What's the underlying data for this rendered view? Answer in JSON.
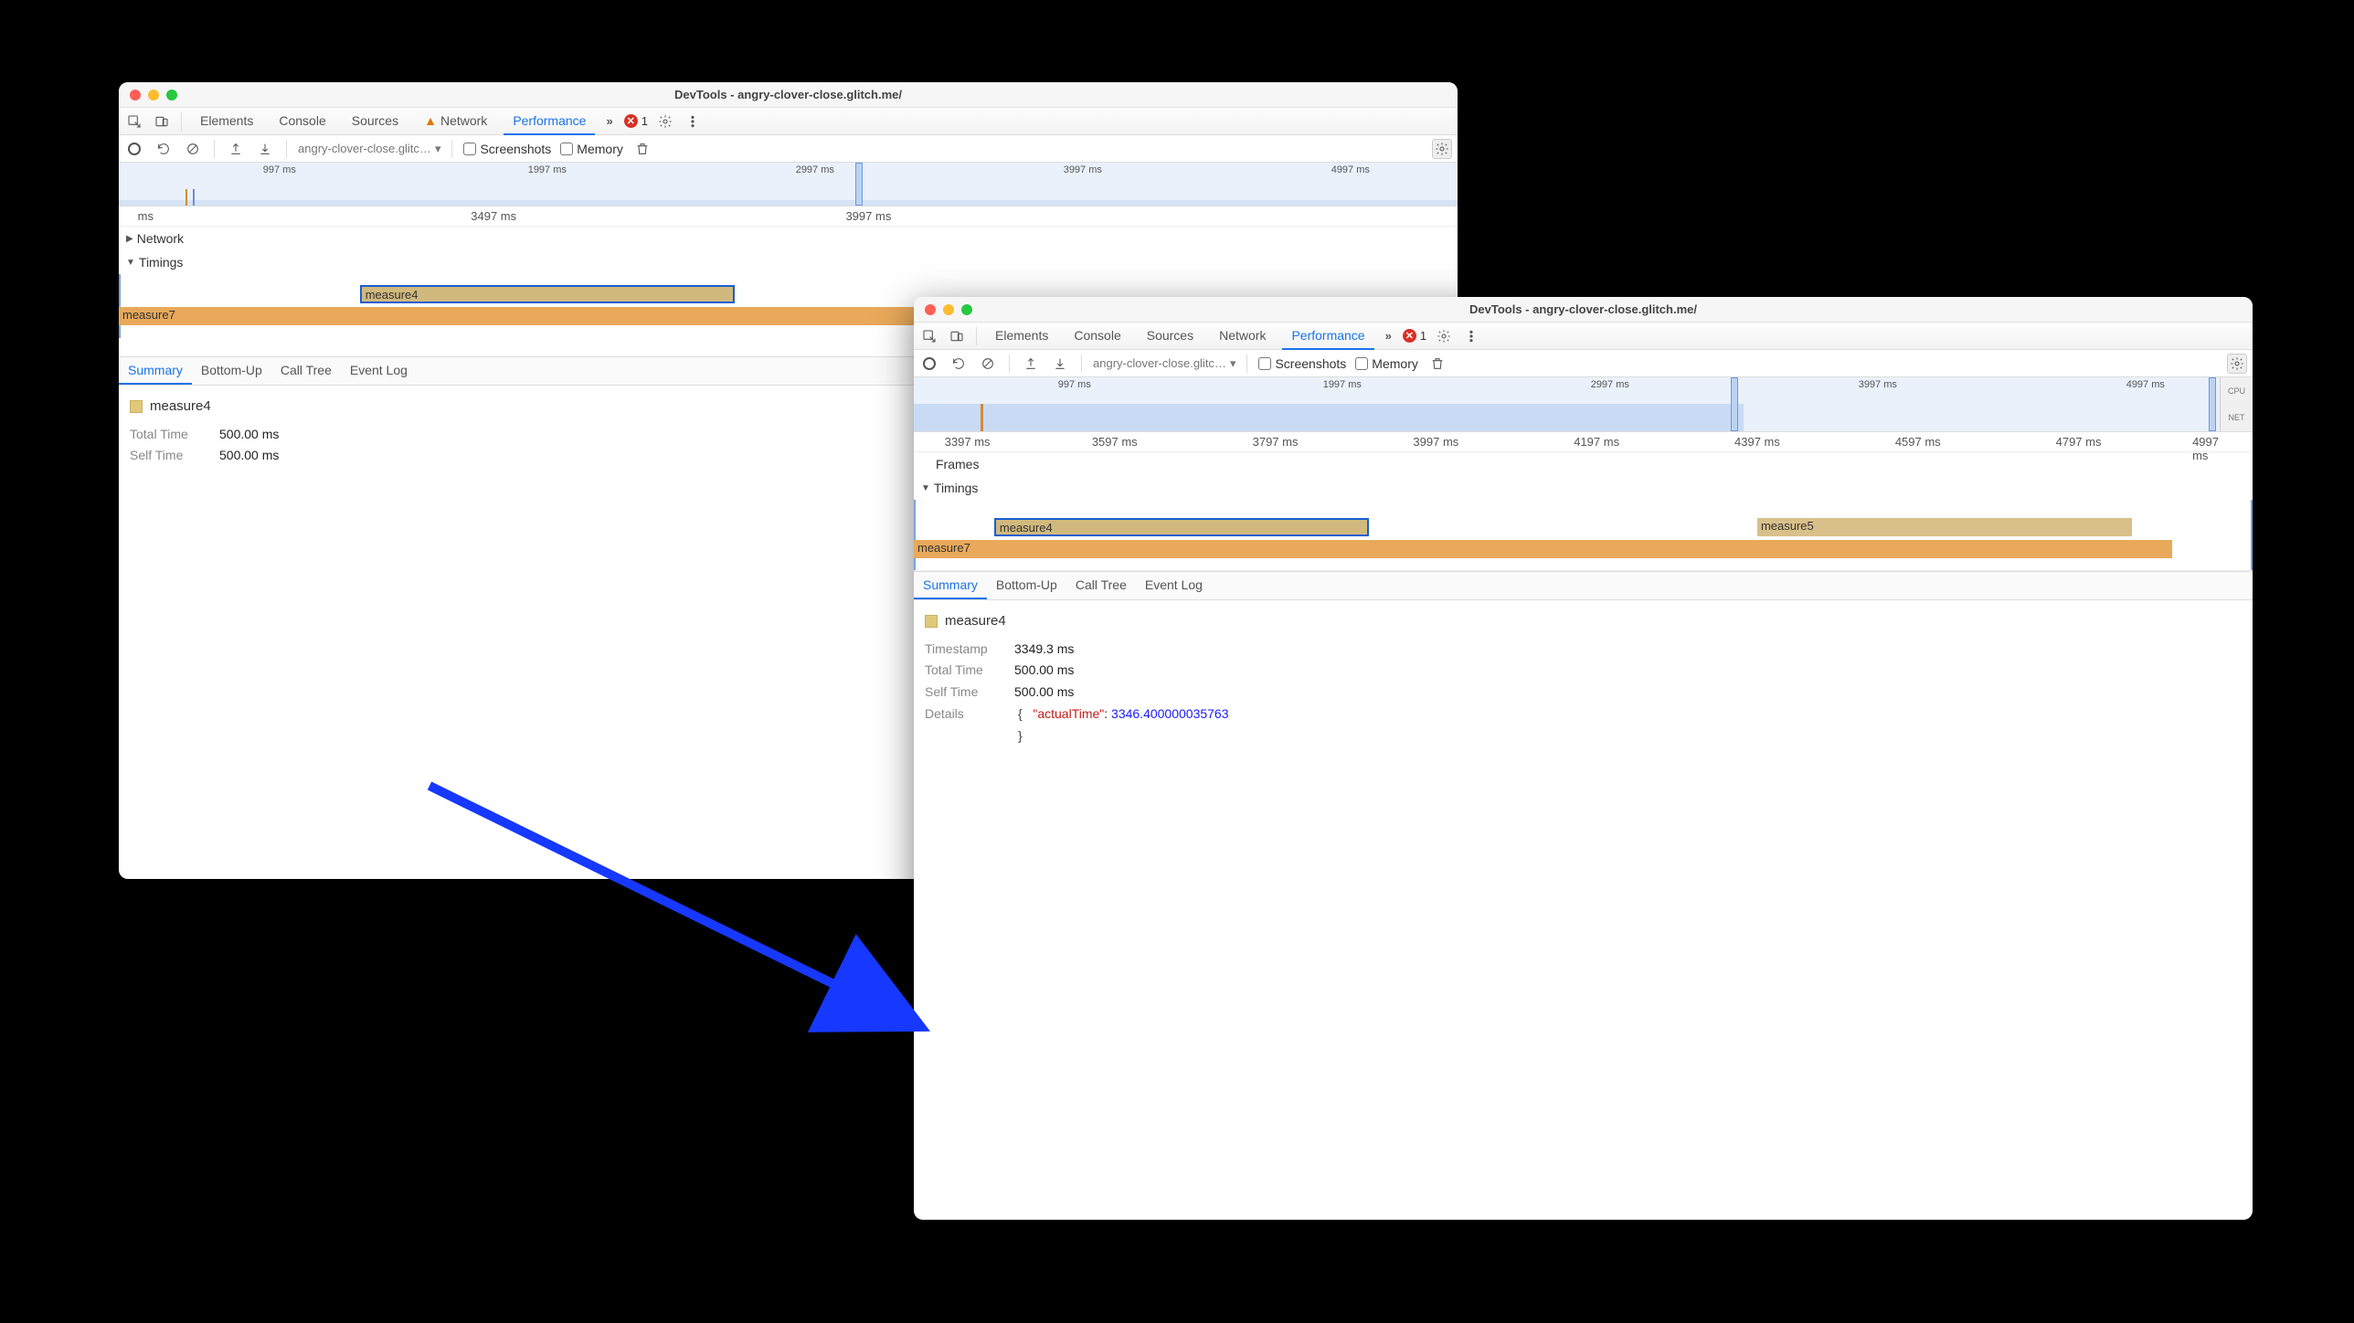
{
  "win1": {
    "title": "DevTools - angry-clover-close.glitch.me/",
    "tabs": {
      "elements": "Elements",
      "console": "Console",
      "sources": "Sources",
      "network": "Network",
      "performance": "Performance"
    },
    "err_count": "1",
    "url": "angry-clover-close.glitc…",
    "screenshots": "Screenshots",
    "memory": "Memory",
    "overview_ticks": [
      "997 ms",
      "1997 ms",
      "2997 ms",
      "3997 ms",
      "4997 ms"
    ],
    "ruler": {
      "ms": "ms",
      "t1": "3497 ms",
      "t2": "3997 ms"
    },
    "tracks": {
      "network": "Network",
      "timings": "Timings"
    },
    "bars": {
      "measure4": "measure4",
      "measure7": "measure7"
    },
    "detail_tabs": {
      "summary": "Summary",
      "bottomup": "Bottom-Up",
      "calltree": "Call Tree",
      "eventlog": "Event Log"
    },
    "detail": {
      "name": "measure4",
      "total_k": "Total Time",
      "total_v": "500.00 ms",
      "self_k": "Self Time",
      "self_v": "500.00 ms"
    }
  },
  "win2": {
    "title": "DevTools - angry-clover-close.glitch.me/",
    "tabs": {
      "elements": "Elements",
      "console": "Console",
      "sources": "Sources",
      "network": "Network",
      "performance": "Performance"
    },
    "err_count": "1",
    "url": "angry-clover-close.glitc…",
    "screenshots": "Screenshots",
    "memory": "Memory",
    "overview_ticks": [
      "997 ms",
      "1997 ms",
      "2997 ms",
      "3997 ms",
      "4997 ms"
    ],
    "overview_labels": {
      "cpu": "CPU",
      "net": "NET"
    },
    "ruler_ticks": [
      "3397 ms",
      "3597 ms",
      "3797 ms",
      "3997 ms",
      "4197 ms",
      "4397 ms",
      "4597 ms",
      "4797 ms",
      "4997 ms"
    ],
    "tracks": {
      "frames": "Frames",
      "timings": "Timings"
    },
    "bars": {
      "measure4": "measure4",
      "measure5": "measure5",
      "measure7": "measure7"
    },
    "detail_tabs": {
      "summary": "Summary",
      "bottomup": "Bottom-Up",
      "calltree": "Call Tree",
      "eventlog": "Event Log"
    },
    "detail": {
      "name": "measure4",
      "ts_k": "Timestamp",
      "ts_v": "3349.3 ms",
      "total_k": "Total Time",
      "total_v": "500.00 ms",
      "self_k": "Self Time",
      "self_v": "500.00 ms",
      "details_k": "Details",
      "json_key": "\"actualTime\"",
      "json_val": "3346.400000035763"
    }
  }
}
